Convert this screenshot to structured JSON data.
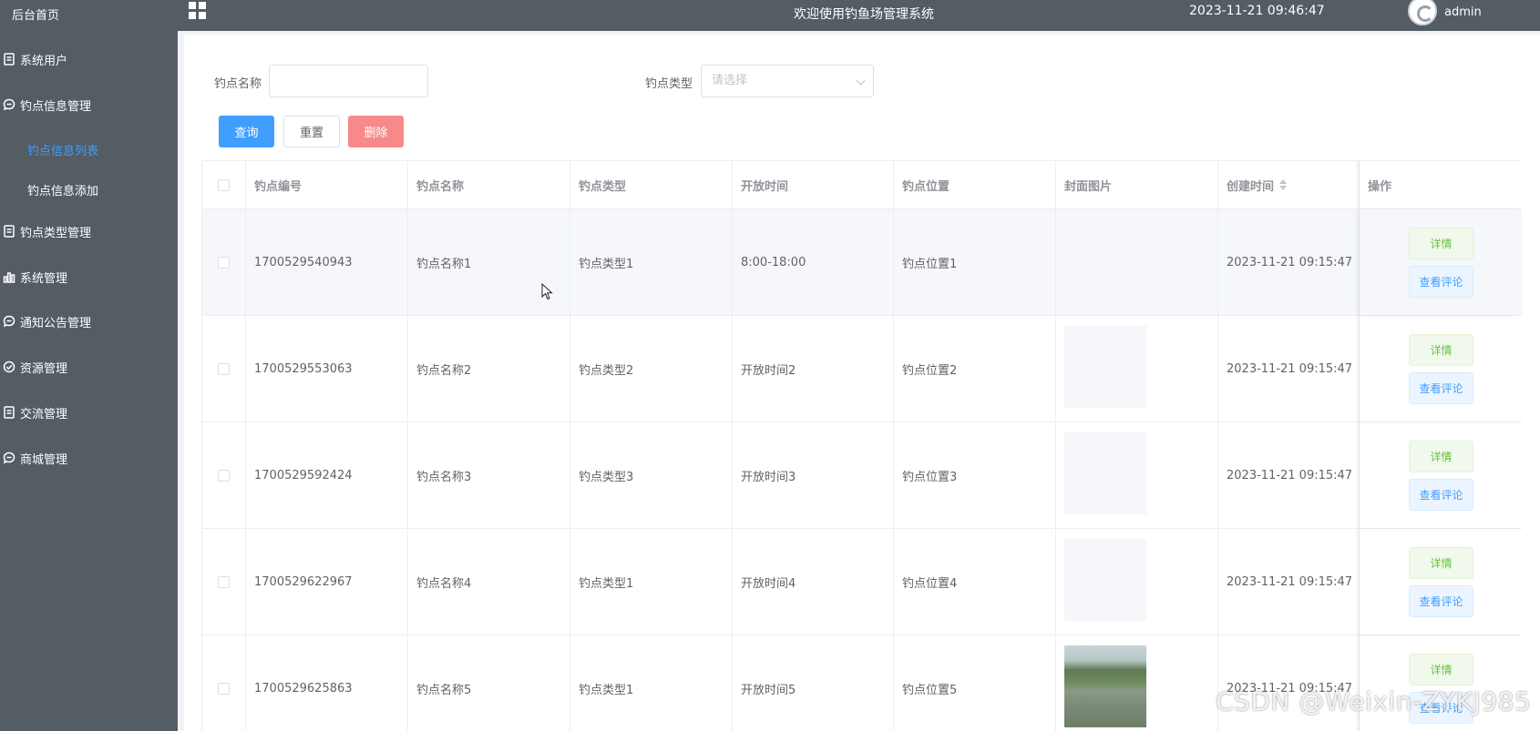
{
  "sidebar": {
    "home": "后台首页",
    "items": [
      {
        "label": "系统用户",
        "icon": "document-icon"
      },
      {
        "label": "钓点信息管理",
        "icon": "chat-icon"
      },
      {
        "label": "钓点类型管理",
        "icon": "document-icon"
      },
      {
        "label": "系统管理",
        "icon": "bar-chart-icon"
      },
      {
        "label": "通知公告管理",
        "icon": "chat-icon"
      },
      {
        "label": "资源管理",
        "icon": "check-circle-icon"
      },
      {
        "label": "交流管理",
        "icon": "document-icon"
      },
      {
        "label": "商城管理",
        "icon": "chat-icon"
      }
    ],
    "sub_items": [
      {
        "label": "钓点信息列表",
        "active": true
      },
      {
        "label": "钓点信息添加",
        "active": false
      }
    ]
  },
  "header": {
    "title": "欢迎使用钓鱼场管理系统",
    "datetime": "2023-11-21 09:46:47",
    "user": "admin"
  },
  "search": {
    "name_label": "钓点名称",
    "name_value": "",
    "type_label": "钓点类型",
    "type_placeholder": "请选择"
  },
  "actions": {
    "query": "查询",
    "reset": "重置",
    "delete": "删除"
  },
  "table": {
    "columns": [
      "钓点编号",
      "钓点名称",
      "钓点类型",
      "开放时间",
      "钓点位置",
      "封面图片",
      "创建时间",
      "操作"
    ],
    "rows": [
      {
        "id": "1700529540943",
        "name": "钓点名称1",
        "type": "钓点类型1",
        "open_time": "8:00-18:00",
        "location": "钓点位置1",
        "cover": "none",
        "created": "2023-11-21 09:15:47"
      },
      {
        "id": "1700529553063",
        "name": "钓点名称2",
        "type": "钓点类型2",
        "open_time": "开放时间2",
        "location": "钓点位置2",
        "cover": "placeholder",
        "created": "2023-11-21 09:15:47"
      },
      {
        "id": "1700529592424",
        "name": "钓点名称3",
        "type": "钓点类型3",
        "open_time": "开放时间3",
        "location": "钓点位置3",
        "cover": "placeholder",
        "created": "2023-11-21 09:15:47"
      },
      {
        "id": "1700529622967",
        "name": "钓点名称4",
        "type": "钓点类型1",
        "open_time": "开放时间4",
        "location": "钓点位置4",
        "cover": "placeholder",
        "created": "2023-11-21 09:15:47"
      },
      {
        "id": "1700529625863",
        "name": "钓点名称5",
        "type": "钓点类型1",
        "open_time": "开放时间5",
        "location": "钓点位置5",
        "cover": "photo",
        "created": "2023-11-21 09:15:47"
      }
    ],
    "op_detail": "详情",
    "op_review": "查看评论"
  },
  "watermark": "CSDN @Weixin-ZYKJ985",
  "colors": {
    "sidebar_bg": "#545c64",
    "primary": "#409eff",
    "danger": "#f78989",
    "success": "#67c23a"
  }
}
